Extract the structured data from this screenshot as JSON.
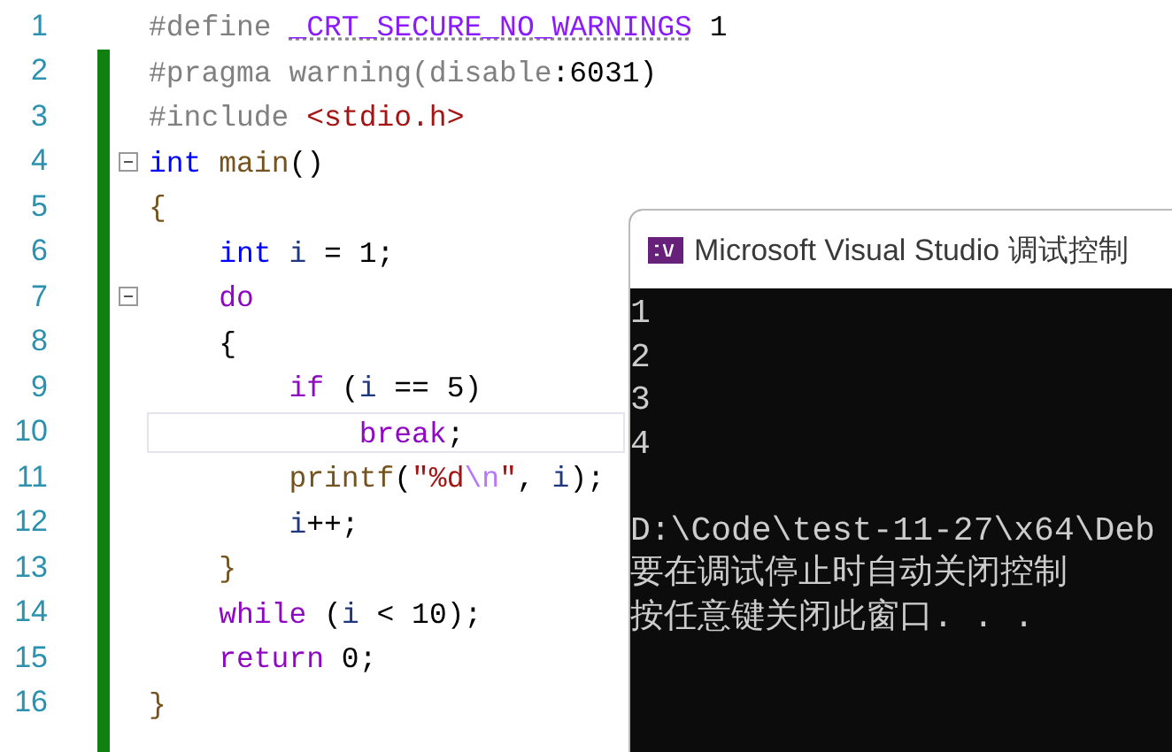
{
  "editor": {
    "lines": [
      {
        "number": "1",
        "changed": false,
        "fold_marker": false,
        "current": false,
        "tokens": [
          {
            "kind": "pre",
            "text": "#define "
          },
          {
            "kind": "macro",
            "text": "_CRT_SECURE_NO_WARNINGS"
          },
          {
            "kind": "plain",
            "text": " 1"
          }
        ]
      },
      {
        "number": "2",
        "changed": true,
        "fold_marker": false,
        "current": false,
        "tokens": [
          {
            "kind": "pre",
            "text": "#pragma warning(disable"
          },
          {
            "kind": "plain",
            "text": ":6031)"
          }
        ]
      },
      {
        "number": "3",
        "changed": true,
        "fold_marker": false,
        "current": false,
        "tokens": [
          {
            "kind": "pre",
            "text": "#include "
          },
          {
            "kind": "str",
            "text": "<stdio.h>"
          }
        ]
      },
      {
        "number": "4",
        "changed": true,
        "fold_marker": true,
        "current": false,
        "tokens": [
          {
            "kind": "kw",
            "text": "int "
          },
          {
            "kind": "fn",
            "text": "main"
          },
          {
            "kind": "plain",
            "text": "()"
          }
        ]
      },
      {
        "number": "5",
        "changed": true,
        "fold_marker": false,
        "current": false,
        "tokens": [
          {
            "kind": "fn",
            "text": "{"
          }
        ]
      },
      {
        "number": "6",
        "changed": true,
        "fold_marker": false,
        "current": false,
        "tokens": [
          {
            "kind": "kw",
            "text": "    int "
          },
          {
            "kind": "var",
            "text": "i"
          },
          {
            "kind": "plain",
            "text": " = 1;"
          }
        ]
      },
      {
        "number": "7",
        "changed": true,
        "fold_marker": true,
        "current": false,
        "tokens": [
          {
            "kind": "ctrl",
            "text": "    do"
          }
        ]
      },
      {
        "number": "8",
        "changed": true,
        "fold_marker": false,
        "current": false,
        "tokens": [
          {
            "kind": "plain",
            "text": "    {"
          }
        ]
      },
      {
        "number": "9",
        "changed": true,
        "fold_marker": false,
        "current": false,
        "tokens": [
          {
            "kind": "ctrl",
            "text": "        if"
          },
          {
            "kind": "plain",
            "text": " ("
          },
          {
            "kind": "var",
            "text": "i"
          },
          {
            "kind": "plain",
            "text": " == 5)"
          }
        ]
      },
      {
        "number": "10",
        "changed": true,
        "fold_marker": false,
        "current": true,
        "tokens": [
          {
            "kind": "ctrl",
            "text": "            break"
          },
          {
            "kind": "plain",
            "text": ";"
          }
        ]
      },
      {
        "number": "11",
        "changed": true,
        "fold_marker": false,
        "current": false,
        "tokens": [
          {
            "kind": "fn",
            "text": "        printf"
          },
          {
            "kind": "plain",
            "text": "("
          },
          {
            "kind": "str",
            "text": "\"%d"
          },
          {
            "kind": "esc",
            "text": "\\n"
          },
          {
            "kind": "str",
            "text": "\""
          },
          {
            "kind": "plain",
            "text": ", "
          },
          {
            "kind": "var",
            "text": "i"
          },
          {
            "kind": "plain",
            "text": ");"
          }
        ]
      },
      {
        "number": "12",
        "changed": true,
        "fold_marker": false,
        "current": false,
        "tokens": [
          {
            "kind": "var",
            "text": "        i"
          },
          {
            "kind": "plain",
            "text": "++;"
          }
        ]
      },
      {
        "number": "13",
        "changed": true,
        "fold_marker": false,
        "current": false,
        "tokens": [
          {
            "kind": "fn",
            "text": "    }"
          }
        ]
      },
      {
        "number": "14",
        "changed": true,
        "fold_marker": false,
        "current": false,
        "tokens": [
          {
            "kind": "ctrl",
            "text": "    while"
          },
          {
            "kind": "plain",
            "text": " ("
          },
          {
            "kind": "var",
            "text": "i"
          },
          {
            "kind": "plain",
            "text": " < 10);"
          }
        ]
      },
      {
        "number": "15",
        "changed": true,
        "fold_marker": false,
        "current": false,
        "tokens": [
          {
            "kind": "ctrl",
            "text": "    return"
          },
          {
            "kind": "plain",
            "text": " 0;"
          }
        ]
      },
      {
        "number": "16",
        "changed": true,
        "fold_marker": false,
        "current": false,
        "tokens": [
          {
            "kind": "fn",
            "text": "}"
          }
        ]
      }
    ]
  },
  "console": {
    "title": "Microsoft Visual Studio 调试控制",
    "output": [
      "1",
      "2",
      "3",
      "4"
    ],
    "messages": [
      "D:\\Code\\test-11-27\\x64\\Deb",
      "要在调试停止时自动关闭控制",
      "按任意键关闭此窗口. . ."
    ]
  }
}
